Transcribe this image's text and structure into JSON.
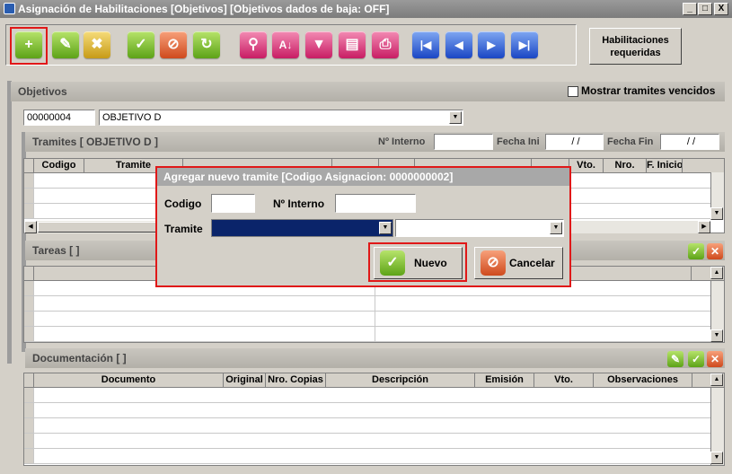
{
  "window": {
    "title": "Asignación de Habilitaciones [Objetivos] [Objetivos dados de baja: OFF]",
    "controls": [
      "_",
      "□",
      "X"
    ]
  },
  "toolbar": {
    "buttons": [
      {
        "name": "add",
        "glyph": "+"
      },
      {
        "name": "edit",
        "glyph": "✎"
      },
      {
        "name": "delete",
        "glyph": "✖"
      },
      {
        "name": "accept",
        "glyph": "✓"
      },
      {
        "name": "cancel",
        "glyph": "⊘"
      },
      {
        "name": "refresh",
        "glyph": "↻"
      },
      {
        "name": "search",
        "glyph": "⚲"
      },
      {
        "name": "sort",
        "glyph": "A↓"
      },
      {
        "name": "filter",
        "glyph": "▼"
      },
      {
        "name": "clipboard",
        "glyph": "▤"
      },
      {
        "name": "print",
        "glyph": "⎙"
      },
      {
        "name": "first",
        "glyph": "|◀"
      },
      {
        "name": "prev",
        "glyph": "◀"
      },
      {
        "name": "next",
        "glyph": "▶"
      },
      {
        "name": "last",
        "glyph": "▶|"
      }
    ],
    "habilitaciones_label": "Habilitaciones requeridas"
  },
  "objetivos": {
    "title": "Objetivos",
    "mostrar_label": "Mostrar tramites vencidos",
    "code": "00000004",
    "name": "OBJETIVO D"
  },
  "tramites": {
    "title": "Tramites [ OBJETIVO D ]",
    "interno_label": "Nº Interno",
    "fecha_ini_label": "Fecha Ini",
    "fecha_ini_value": "/ /",
    "fecha_fin_label": "Fecha Fin",
    "fecha_fin_value": "/ /",
    "columns": [
      "Codigo",
      "Tramite",
      "",
      "",
      "",
      "",
      "",
      "Vto.",
      "Nro.",
      "F. Inicio"
    ]
  },
  "tareas": {
    "title": "Tareas [ ]"
  },
  "documentacion": {
    "title": "Documentación [ ]",
    "columns": [
      "Documento",
      "Original",
      "Nro. Copias",
      "Descripción",
      "Emisión",
      "Vto.",
      "Observaciones"
    ]
  },
  "dialog": {
    "title": "Agregar nuevo tramite [Codigo Asignacion: 0000000002]",
    "codigo_label": "Codigo",
    "interno_label": "Nº Interno",
    "tramite_label": "Tramite",
    "nuevo_label": "Nuevo",
    "cancelar_label": "Cancelar"
  },
  "colors": {
    "highlight": "#e01818",
    "selected": "#0a246a"
  }
}
